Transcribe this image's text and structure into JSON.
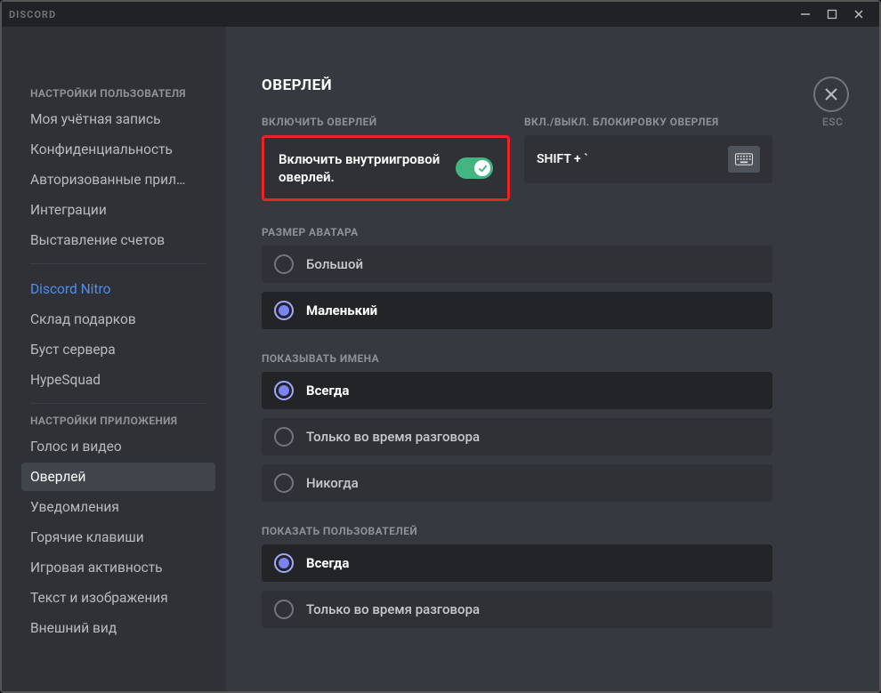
{
  "titlebar": {
    "app": "DISCORD"
  },
  "esc": {
    "label": "ESC"
  },
  "sidebar": {
    "section_user": "НАСТРОЙКИ ПОЛЬЗОВАТЕЛЯ",
    "section_app": "НАСТРОЙКИ ПРИЛОЖЕНИЯ",
    "items_user": [
      "Моя учётная запись",
      "Конфиденциальность",
      "Авторизованные прил…",
      "Интеграции",
      "Выставление счетов"
    ],
    "items_nitro": [
      "Discord Nitro",
      "Склад подарков",
      "Буст сервера",
      "HypeSquad"
    ],
    "items_app": [
      "Голос и видео",
      "Оверлей",
      "Уведомления",
      "Горячие клавиши",
      "Игровая активность",
      "Текст и изображения",
      "Внешний вид"
    ],
    "selected": "Оверлей"
  },
  "main": {
    "title": "ОВЕРЛЕЙ",
    "enable": {
      "header": "ВКЛЮЧИТЬ ОВЕРЛЕЙ",
      "label": "Включить внутриигровой оверлей.",
      "on": true
    },
    "hotkey": {
      "header": "ВКЛ./ВЫКЛ. БЛОКИРОВКУ ОВЕРЛЕЯ",
      "value": "SHIFT + `"
    },
    "avatar_size": {
      "header": "РАЗМЕР АВАТАРА",
      "options": [
        "Большой",
        "Маленький"
      ],
      "selected": "Маленький"
    },
    "show_names": {
      "header": "ПОКАЗЫВАТЬ ИМЕНА",
      "options": [
        "Всегда",
        "Только во время разговора",
        "Никогда"
      ],
      "selected": "Всегда"
    },
    "show_users": {
      "header": "ПОКАЗАТЬ ПОЛЬЗОВАТЕЛЕЙ",
      "options": [
        "Всегда",
        "Только во время разговора"
      ],
      "selected": "Всегда"
    }
  }
}
